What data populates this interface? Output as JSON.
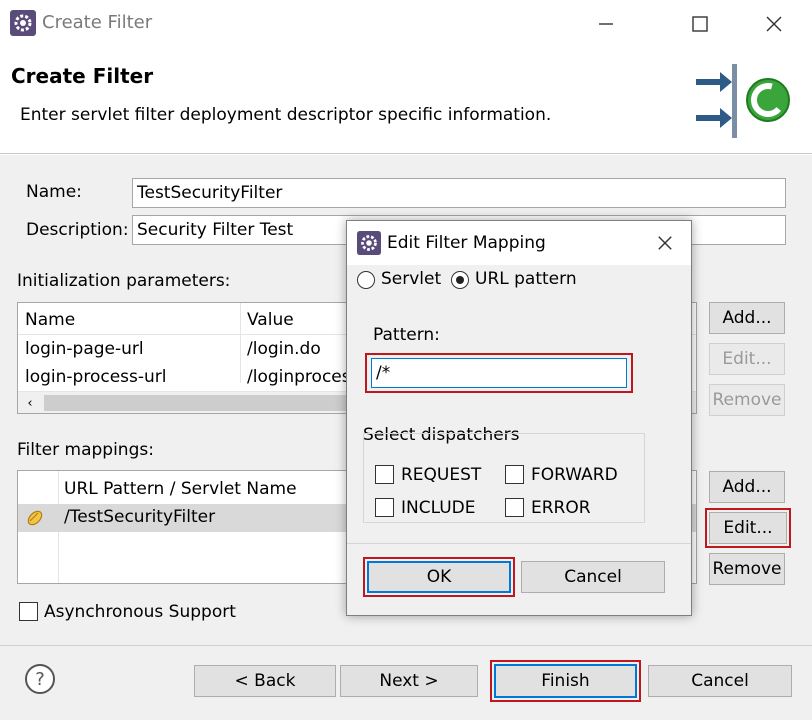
{
  "window": {
    "title": "Create Filter",
    "icon": "gear-app-icon",
    "controls": [
      "minimize-icon",
      "maximize-icon",
      "close-icon"
    ]
  },
  "banner": {
    "title": "Create Filter",
    "description": "Enter servlet filter deployment descriptor specific information.",
    "icon": "filter-wizard-icon"
  },
  "form": {
    "name_label": "Name:",
    "name_value": "TestSecurityFilter",
    "description_label": "Description:",
    "description_value": "Security Filter Test",
    "init_params_label": "Initialization parameters:",
    "init_params": {
      "columns": [
        "Name",
        "Value"
      ],
      "rows": [
        {
          "name": "login-page-url",
          "value": "/login.do"
        },
        {
          "name": "login-process-url",
          "value": "/loginproces"
        }
      ],
      "buttons": {
        "add": "Add...",
        "edit": "Edit...",
        "remove": "Remove"
      }
    },
    "mappings_label": "Filter mappings:",
    "mappings": {
      "column": "URL Pattern / Servlet Name",
      "rows": [
        {
          "value": "/TestSecurityFilter"
        }
      ],
      "buttons": {
        "add": "Add...",
        "edit": "Edit...",
        "remove": "Remove"
      }
    },
    "async_label": "Asynchronous Support",
    "async_checked": false
  },
  "footer": {
    "help_icon": "help-icon",
    "back": "< Back",
    "next": "Next >",
    "finish": "Finish",
    "cancel": "Cancel"
  },
  "dialog": {
    "title": "Edit Filter Mapping",
    "radio_servlet": "Servlet",
    "radio_url": "URL pattern",
    "selected": "URL pattern",
    "pattern_label": "Pattern:",
    "pattern_value": "/*",
    "dispatchers_label": "Select dispatchers",
    "dispatchers": [
      "REQUEST",
      "FORWARD",
      "INCLUDE",
      "ERROR"
    ],
    "ok": "OK",
    "cancel": "Cancel"
  },
  "colors": {
    "highlight": "#c0161e",
    "selected_row": "#d9d9d9",
    "accent_blue": "#0078d7"
  }
}
